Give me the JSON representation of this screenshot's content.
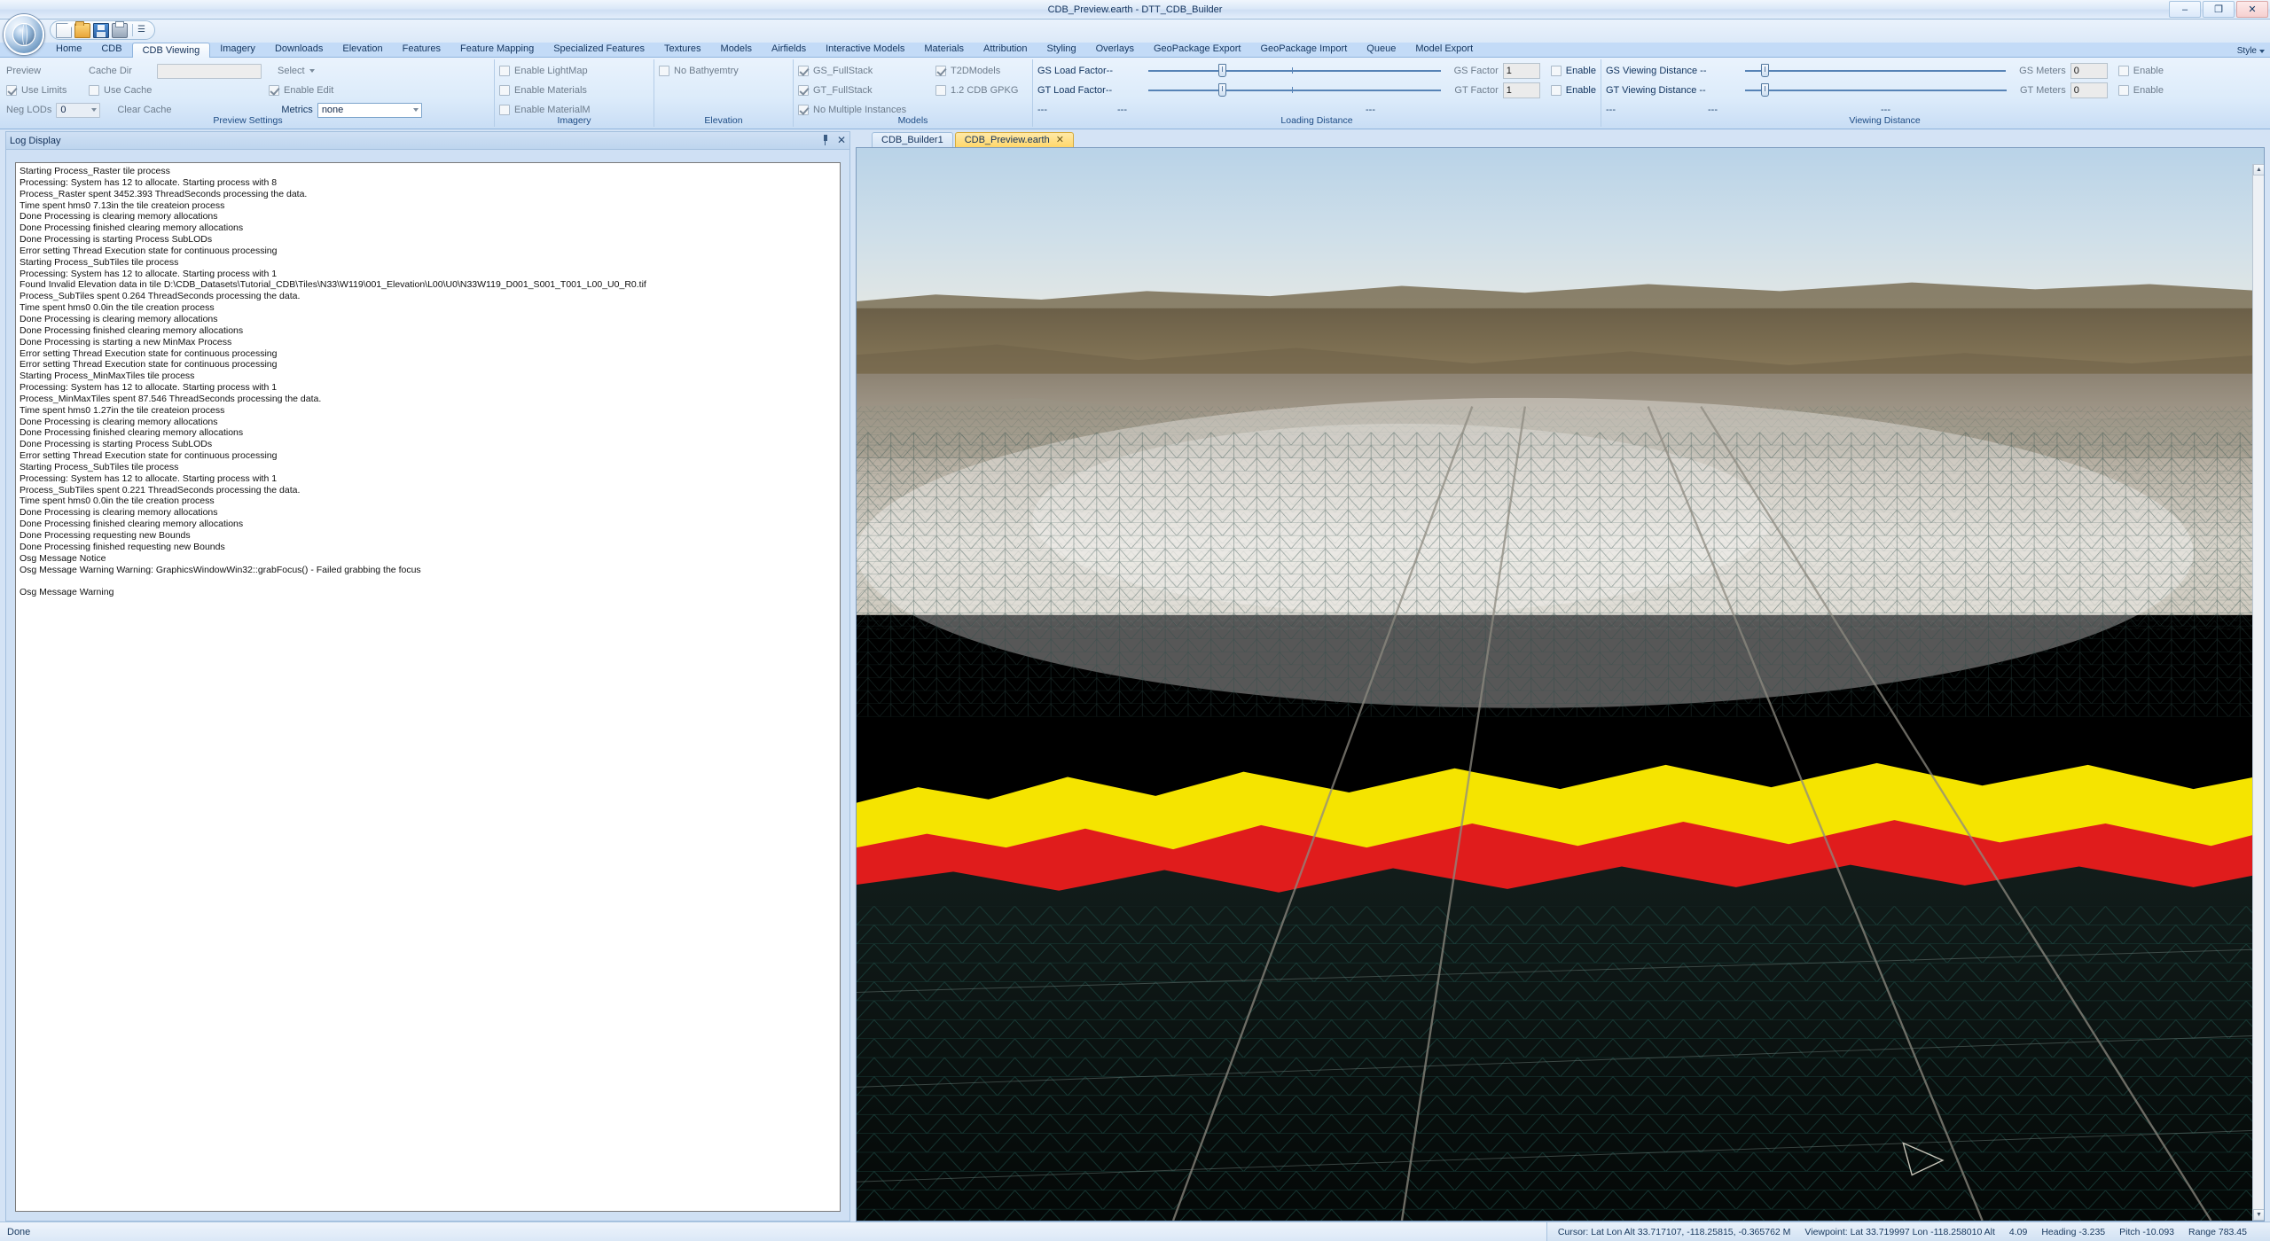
{
  "window": {
    "title": "CDB_Preview.earth - DTT_CDB_Builder",
    "minimize": "–",
    "maximize": "❐",
    "close": "✕"
  },
  "quick_access": {
    "new": "new-document-icon",
    "open": "open-folder-icon",
    "save": "save-disk-icon",
    "print": "print-icon",
    "more": "☰"
  },
  "tabs": [
    {
      "label": "Home",
      "active": false
    },
    {
      "label": "CDB",
      "active": false
    },
    {
      "label": "CDB Viewing",
      "active": true
    },
    {
      "label": "Imagery",
      "active": false
    },
    {
      "label": "Downloads",
      "active": false
    },
    {
      "label": "Elevation",
      "active": false
    },
    {
      "label": "Features",
      "active": false
    },
    {
      "label": "Feature Mapping",
      "active": false
    },
    {
      "label": "Specialized Features",
      "active": false
    },
    {
      "label": "Textures",
      "active": false
    },
    {
      "label": "Models",
      "active": false
    },
    {
      "label": "Airfields",
      "active": false
    },
    {
      "label": "Interactive Models",
      "active": false
    },
    {
      "label": "Materials",
      "active": false
    },
    {
      "label": "Attribution",
      "active": false
    },
    {
      "label": "Styling",
      "active": false
    },
    {
      "label": "Overlays",
      "active": false
    },
    {
      "label": "GeoPackage Export",
      "active": false
    },
    {
      "label": "GeoPackage Import",
      "active": false
    },
    {
      "label": "Queue",
      "active": false
    },
    {
      "label": "Model Export",
      "active": false
    }
  ],
  "style_button": {
    "label": "Style"
  },
  "ribbon": {
    "preview_settings": {
      "title": "Preview Settings",
      "preview_label": "Preview",
      "cache_dir_label": "Cache Dir",
      "cache_dir_value": "",
      "use_limits_label": "Use Limits",
      "use_limits_checked": true,
      "use_cache_label": "Use Cache",
      "use_cache_checked": false,
      "neg_lods_label": "Neg LODs",
      "neg_lods_value": "0",
      "clear_cache_label": "Clear Cache",
      "select_label": "Select",
      "enable_edit_label": "Enable Edit",
      "enable_edit_checked": true,
      "metrics_label": "Metrics",
      "metrics_value": "none"
    },
    "imagery": {
      "title": "Imagery",
      "items": [
        {
          "label": "Enable LightMap",
          "checked": false
        },
        {
          "label": "Enable Materials",
          "checked": false
        },
        {
          "label": "Enable MaterialM",
          "checked": false
        }
      ]
    },
    "elevation": {
      "title": "Elevation",
      "items": [
        {
          "label": "No Bathyemtry",
          "checked": false
        }
      ]
    },
    "models": {
      "title": "Models",
      "col1": [
        {
          "label": "GS_FullStack",
          "checked": true
        },
        {
          "label": "GT_FullStack",
          "checked": true
        },
        {
          "label": "No Multiple Instances",
          "checked": true
        }
      ],
      "col2": [
        {
          "label": "T2DModels",
          "checked": true
        },
        {
          "label": "1.2 CDB GPKG",
          "checked": false
        }
      ]
    },
    "loading_distance": {
      "title": "Loading Distance",
      "rows": [
        {
          "label": "GS Load Factor--",
          "slider_pct": 24,
          "factor_label": "GS Factor",
          "factor_value": "1",
          "enable_label": "Enable",
          "enable_checked": false
        },
        {
          "label": "GT Load Factor--",
          "slider_pct": 24,
          "factor_label": "GT Factor",
          "factor_value": "1",
          "enable_label": "Enable",
          "enable_checked": false
        }
      ],
      "dash_left": "---",
      "dash_mid": "---",
      "dash_right": "---"
    },
    "viewing_distance": {
      "title": "Viewing Distance",
      "rows": [
        {
          "label": "GS Viewing Distance --",
          "slider_pct": 6,
          "meters_label": "GS Meters",
          "meters_value": "0",
          "enable_label": "Enable",
          "enable_checked": false
        },
        {
          "label": "GT Viewing Distance --",
          "slider_pct": 6,
          "meters_label": "GT Meters",
          "meters_value": "0",
          "enable_label": "Enable",
          "enable_checked": false
        }
      ],
      "dash_left": "---",
      "dash_mid": "---",
      "dash_right": "---"
    }
  },
  "log_panel": {
    "title": "Log Display",
    "pin": "pin-icon",
    "close": "✕",
    "lines": [
      "Starting Process_Raster tile process",
      "Processing: System has 12 to allocate. Starting process with 8",
      "Process_Raster spent 3452.393 ThreadSeconds processing the data.",
      "Time spent hms0 7.13in the tile createion process",
      "Done Processing is clearing memory allocations",
      "Done Processing finished clearing memory allocations",
      "Done Processing is starting Process SubLODs",
      "Error setting Thread Execution state for continuous processing",
      "Starting Process_SubTiles tile process",
      "Processing: System has 12 to allocate. Starting process with 1",
      "Found Invalid Elevation data in tile D:\\CDB_Datasets\\Tutorial_CDB\\Tiles\\N33\\W119\\001_Elevation\\L00\\U0\\N33W119_D001_S001_T001_L00_U0_R0.tif",
      "Process_SubTiles spent 0.264 ThreadSeconds processing the data.",
      "Time spent hms0 0.0in the tile creation process",
      "Done Processing is clearing memory allocations",
      "Done Processing finished clearing memory allocations",
      "Done Processing is starting a new MinMax Process",
      "Error setting Thread Execution state for continuous processing",
      "Error setting Thread Execution state for continuous processing",
      "Starting Process_MinMaxTiles tile process",
      "Processing: System has 12 to allocate. Starting process with 1",
      "Process_MinMaxTiles spent 87.546 ThreadSeconds processing the data.",
      "Time spent hms0 1.27in the tile createion process",
      "Done Processing is clearing memory allocations",
      "Done Processing finished clearing memory allocations",
      "Done Processing is starting Process SubLODs",
      "Error setting Thread Execution state for continuous processing",
      "Starting Process_SubTiles tile process",
      "Processing: System has 12 to allocate. Starting process with 1",
      "Process_SubTiles spent 0.221 ThreadSeconds processing the data.",
      "Time spent hms0 0.0in the tile creation process",
      "Done Processing is clearing memory allocations",
      "Done Processing finished clearing memory allocations",
      "Done Processing requesting new Bounds",
      "Done Processing finished requesting new Bounds",
      "Osg Message Notice",
      "Osg Message Warning Warning: GraphicsWindowWin32::grabFocus() - Failed grabbing the focus",
      "",
      "Osg Message Warning"
    ]
  },
  "view_tabs": [
    {
      "label": "CDB_Builder1",
      "active": false,
      "closable": false
    },
    {
      "label": "CDB_Preview.earth",
      "active": true,
      "closable": true,
      "close": "✕"
    }
  ],
  "statusbar": {
    "left": "Done",
    "cursor": "Cursor: Lat Lon Alt 33.717107, -118.25815, -0.365762 M",
    "viewpoint": "Viewpoint: Lat 33.719997 Lon -118.258010 Alt",
    "alt": "4.09",
    "heading": "Heading -3.235",
    "pitch": "Pitch -10.093",
    "range": "Range   783.45"
  },
  "colors": {
    "accent": "#1d4b84",
    "ribbon_bg": "#dcebfa",
    "tabstrip": "#c3dbf7",
    "active_tab": "#ffd76a",
    "terrain_yellow": "#f5e400",
    "terrain_red": "#e01c1c",
    "terrain_dark": "#0b1512",
    "mesh_teal": "#2e8b84"
  }
}
